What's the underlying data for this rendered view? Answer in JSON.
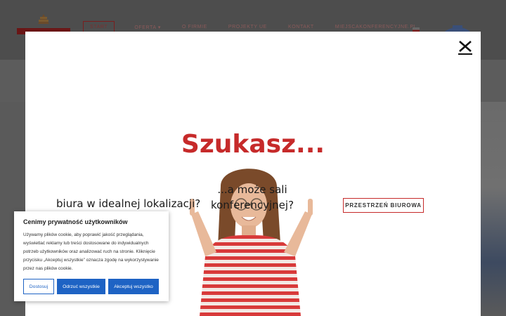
{
  "header": {
    "nav": [
      "START",
      "OFERTA ▾",
      "O FIRMIE",
      "PROJEKTY UE",
      "KONTAKT",
      "MIEJSCAKONFERENCYJNE.PL"
    ],
    "lang": "▾"
  },
  "modal": {
    "title": "Szukasz...",
    "left_text": "biura w idealnej lokalizacji?",
    "mid_text": "...a może sali konferencyjnej?",
    "office_button": "PRZESTRZEŃ BIUROWA",
    "close_icon": "close-icon"
  },
  "cookie": {
    "title": "Cenimy prywatność użytkowników",
    "text": "Używamy plików cookie, aby poprawić jakość przeglądania, wyświetlać reklamy lub treści dostosowane do indywidualnych potrzeb użytkowników oraz analizować ruch na stronie. Kliknięcie przycisku „Akceptuj wszystkie” oznacza zgodę na wykorzystywanie przez nas plików cookie.",
    "btn_customize": "Dostosuj",
    "btn_reject": "Odrzuć wszystkie",
    "btn_accept": "Akceptuj wszystko"
  },
  "colors": {
    "accent": "#c62a2a",
    "cookie_blue": "#1e63c4"
  }
}
